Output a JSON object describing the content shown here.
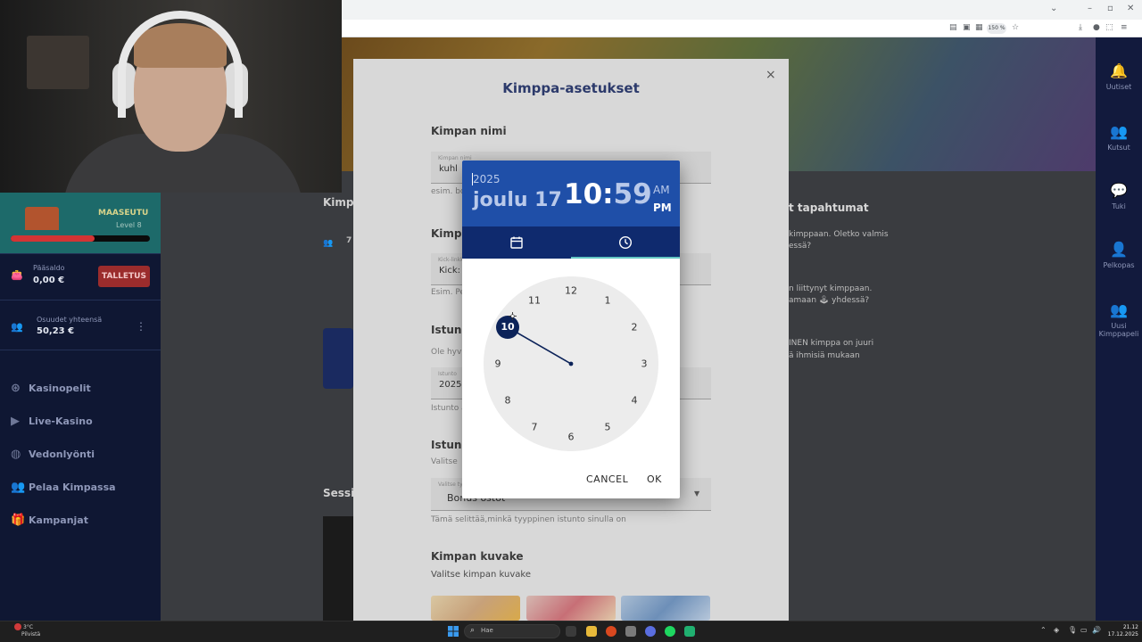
{
  "browser": {
    "zoom": "150 %"
  },
  "right_nav": [
    {
      "label": "Uutiset",
      "icon": "bell-icon"
    },
    {
      "label": "Kutsut",
      "icon": "group-icon"
    },
    {
      "label": "Tuki",
      "icon": "chat-icon"
    },
    {
      "label": "Pelkopas",
      "icon": "guide-icon"
    },
    {
      "label": "Uusi Kimppapeli",
      "icon": "new-group-icon"
    }
  ],
  "left_nav": {
    "level_name": "MAASEUTU",
    "level_num": "Level 8",
    "level_progress": 0.6,
    "balance_label": "Pääsaldo",
    "balance_value": "0,00 €",
    "deposit_label": "TALLETUS",
    "shares_label": "Osuudet yhteensä",
    "shares_value": "50,23 €",
    "menu": [
      {
        "label": "Kasinopelit",
        "icon": "casino-chip-icon"
      },
      {
        "label": "Live-Kasino",
        "icon": "live-icon"
      },
      {
        "label": "Vedonlyönti",
        "icon": "ball-icon"
      },
      {
        "label": "Pelaa Kimpassa",
        "icon": "group-icon"
      },
      {
        "label": "Kampanjat",
        "icon": "gift-icon"
      }
    ]
  },
  "background": {
    "left_title_partial": "Kimp",
    "members_partial": "7",
    "sessions_partial": "Sessi",
    "events_title_partial": "t tapahtumat",
    "events": [
      "kimppaan. Oletko valmis",
      "essä?",
      "n liittynyt kimppaan.",
      "amaan 🕹 yhdessä?",
      "INEN kimppa on juuri",
      "ä ihmisiä mukaan"
    ]
  },
  "modal": {
    "title": "Kimppa-asetukset",
    "close": "×",
    "sections": {
      "name_title": "Kimpan nimi",
      "name_field_label": "Kimpan nimi",
      "name_field_value": "kuhl",
      "name_helper": "esim. bo",
      "kick_title": "Kimp",
      "kick_field_label": "Kick-linkki",
      "kick_field_value": "Kick:",
      "kick_helper": "Esim. Pe",
      "session_title": "Istunn",
      "session_helper": "Ole hyv",
      "session_field_label": "Istunto",
      "session_field_value": "2025-",
      "session_helper2": "Istunto a",
      "type_title": "Istunn",
      "type_helper": "Valitse",
      "type_field_label": "Valitse tyyppi",
      "type_field_value": "Bonus ostot",
      "type_description": "Tämä selittää,minkä tyyppinen istunto sinulla on",
      "icon_title": "Kimpan kuvake",
      "icon_helper": "Valitse kimpan kuvake"
    }
  },
  "picker": {
    "year": "2025",
    "date": "joulu 17",
    "hour": "10",
    "separator": ":",
    "minute": "59",
    "am": "AM",
    "pm": "PM",
    "selected_hour": "10",
    "hours": [
      "12",
      "1",
      "2",
      "3",
      "4",
      "5",
      "6",
      "7",
      "8",
      "9",
      "10",
      "11"
    ],
    "cancel": "CANCEL",
    "ok": "OK"
  },
  "taskbar": {
    "weather_temp": "3°C",
    "weather_desc": "Pilvistä",
    "search": "Hae",
    "time": "21.12",
    "date": "17.12.2025"
  },
  "colors": {
    "picker_header": "#1f4fa8",
    "picker_tabs": "#0f2a6e",
    "selected_hour": "#0c2359",
    "left_nav_bg": "#0f1733",
    "deposit": "#9b2c2c"
  }
}
